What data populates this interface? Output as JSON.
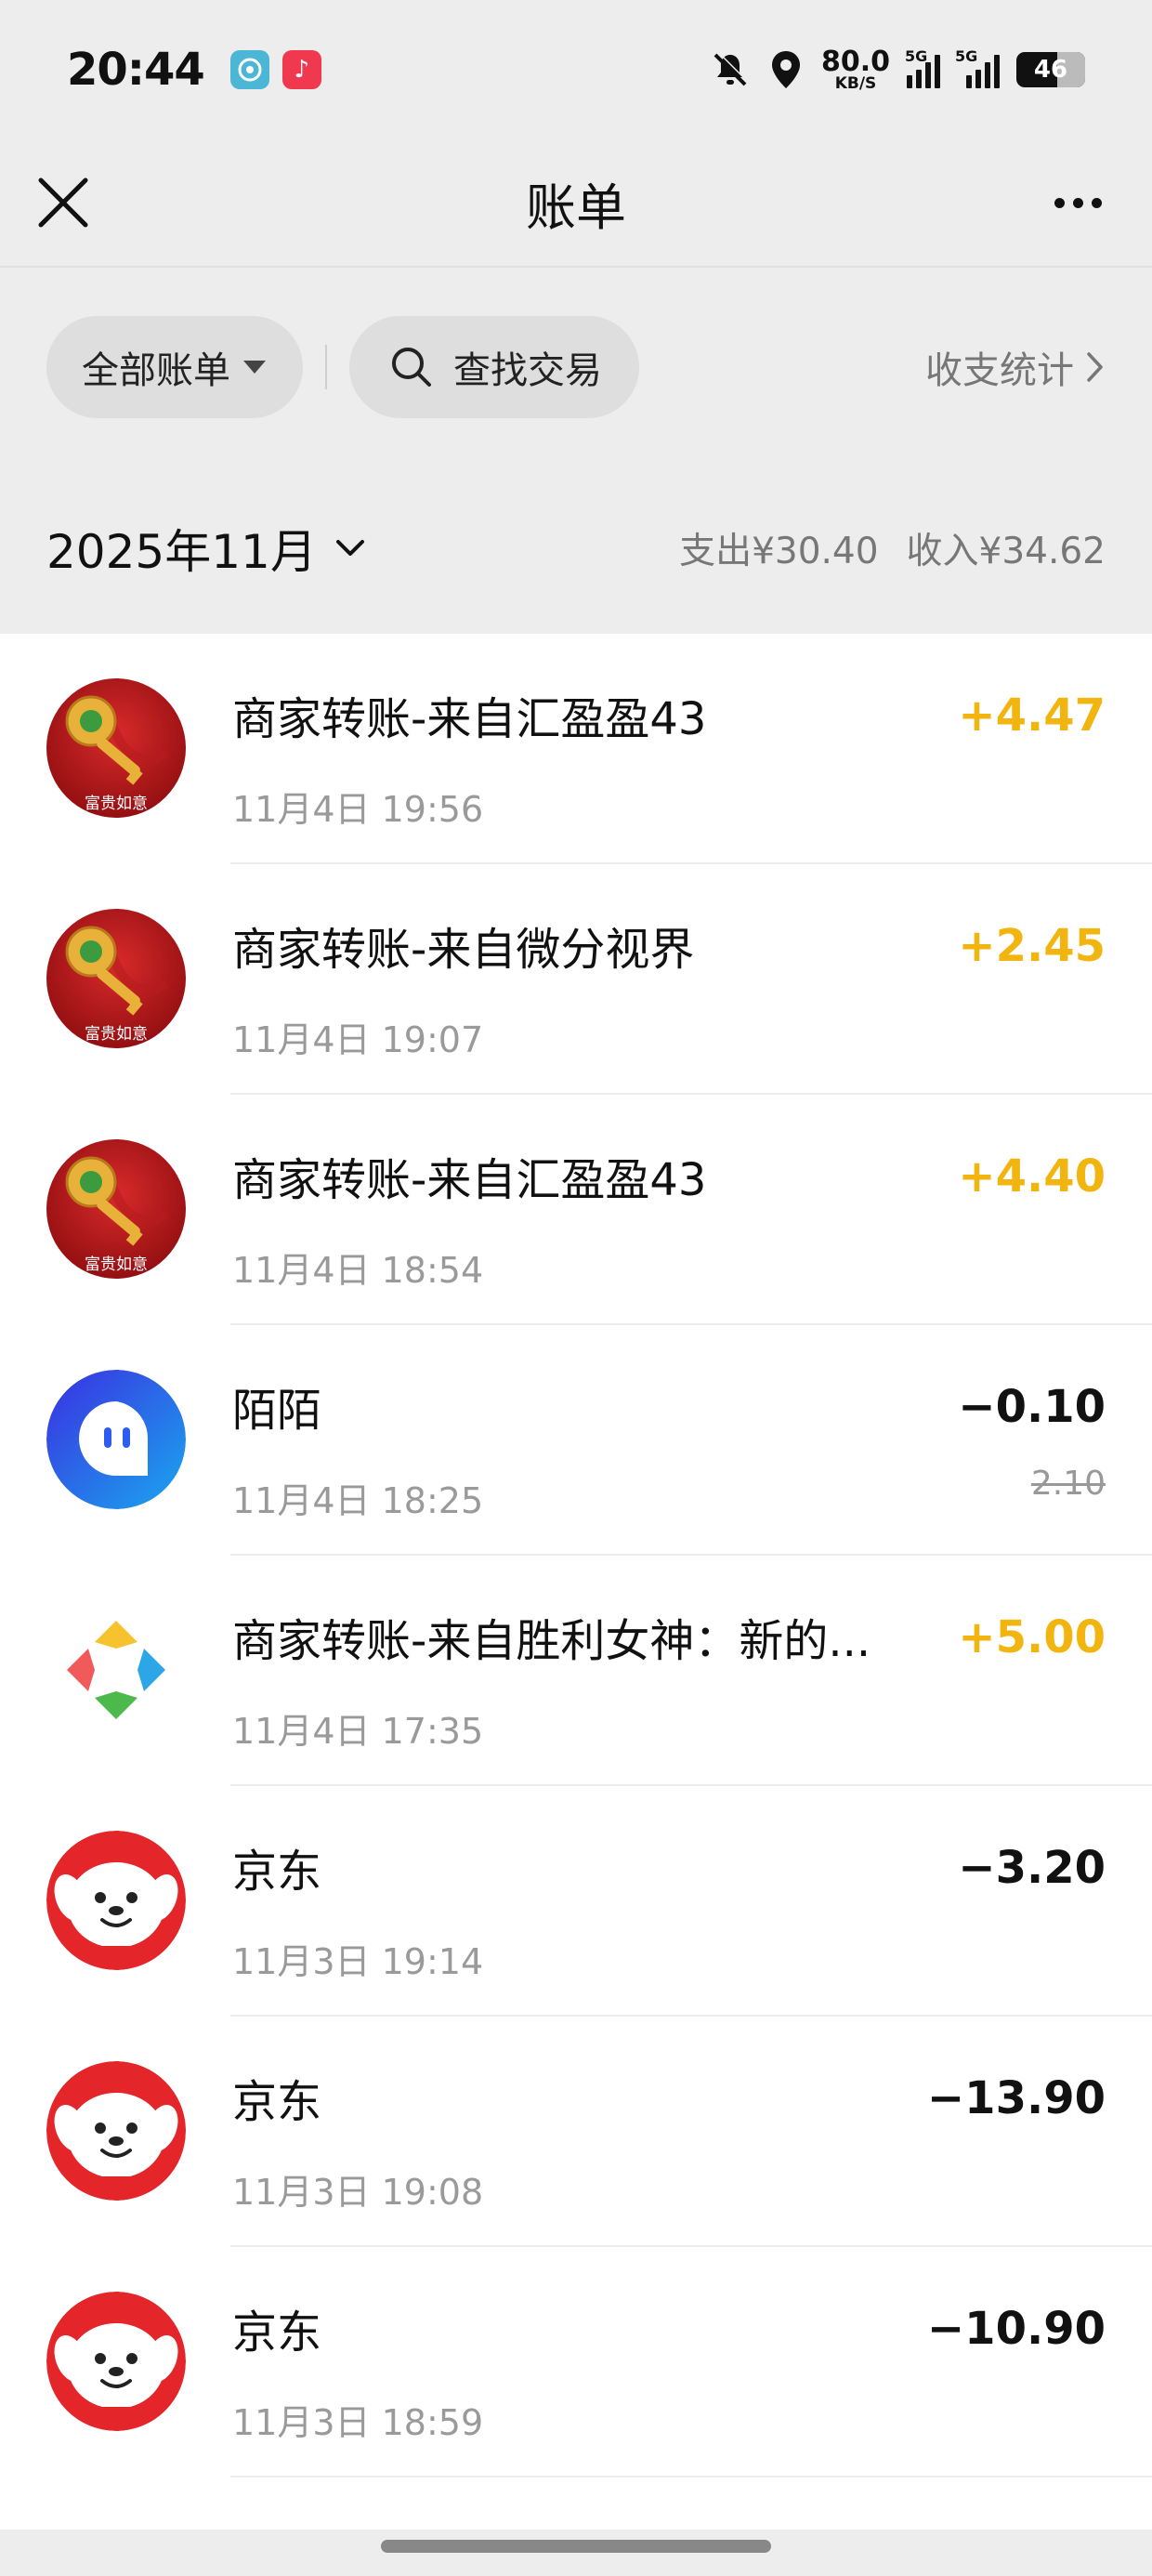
{
  "status_bar": {
    "time": "20:44",
    "network_speed_value": "80.0",
    "network_speed_unit": "KB/S",
    "sim1_label": "5G",
    "sim2_label": "5G",
    "battery": "46"
  },
  "nav": {
    "title": "账单"
  },
  "filters": {
    "all_bills_label": "全部账单",
    "search_label": "查找交易",
    "stats_label": "收支统计"
  },
  "month": {
    "label": "2025年11月",
    "expense_summary": "支出¥30.40",
    "income_summary": "收入¥34.62"
  },
  "colors": {
    "income": "#f2b50f",
    "expense": "#111111",
    "jd_red": "#e4262a",
    "momo_blue": "#2e5bf0"
  },
  "transactions": [
    {
      "icon": "golden-key-icon",
      "avatar_text": "富贵如意",
      "title": "商家转账-来自汇盈盈43",
      "time": "11月4日 19:56",
      "amount": "+4.47",
      "type": "income"
    },
    {
      "icon": "golden-key-icon",
      "avatar_text": "富贵如意",
      "title": "商家转账-来自微分视界",
      "time": "11月4日 19:07",
      "amount": "+2.45",
      "type": "income"
    },
    {
      "icon": "golden-key-icon",
      "avatar_text": "富贵如意",
      "title": "商家转账-来自汇盈盈43",
      "time": "11月4日 18:54",
      "amount": "+4.40",
      "type": "income"
    },
    {
      "icon": "momo-icon",
      "title": "陌陌",
      "time": "11月4日 18:25",
      "amount": "−0.10",
      "original_amount": "2.10",
      "type": "expense"
    },
    {
      "icon": "pinwheel-icon",
      "title": "商家转账-来自胜利女神：新的...",
      "time": "11月4日 17:35",
      "amount": "+5.00",
      "type": "income"
    },
    {
      "icon": "jd-dog-icon",
      "title": "京东",
      "time": "11月3日 19:14",
      "amount": "−3.20",
      "type": "expense"
    },
    {
      "icon": "jd-dog-icon",
      "title": "京东",
      "time": "11月3日 19:08",
      "amount": "−13.90",
      "type": "expense"
    },
    {
      "icon": "jd-dog-icon",
      "title": "京东",
      "time": "11月3日 18:59",
      "amount": "−10.90",
      "type": "expense"
    }
  ]
}
